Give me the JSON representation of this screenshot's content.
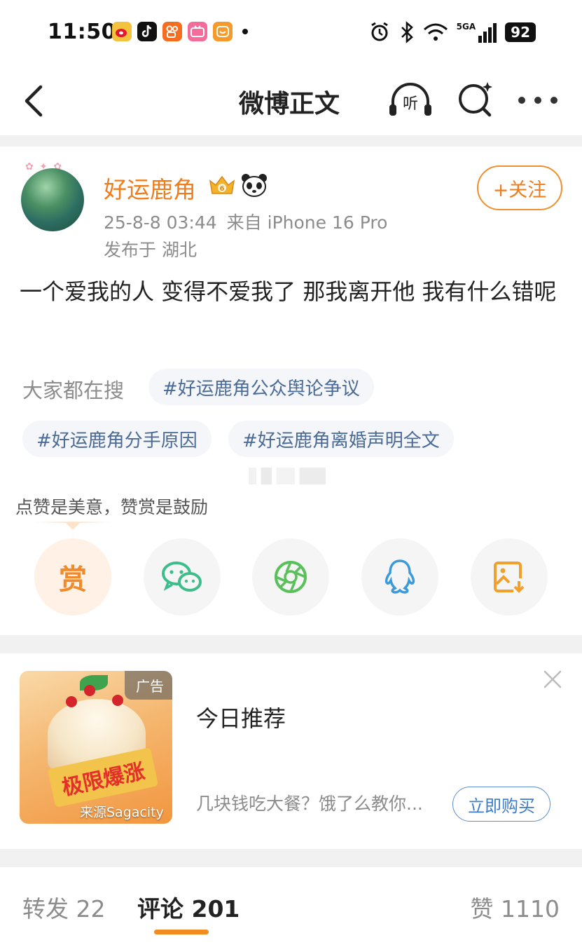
{
  "status_bar": {
    "time": "11:50",
    "battery": "92",
    "network": "5GA",
    "app_icons": [
      "weibo-icon",
      "tiktok-icon",
      "kuaishou-icon",
      "bilibili-icon",
      "taobao-icon"
    ]
  },
  "nav": {
    "title": "微博正文",
    "listen_label": "听"
  },
  "post": {
    "username": "好运鹿角",
    "follow_label": "+关注",
    "date": "25-8-8 03:44",
    "source": "来自 iPhone 16 Pro",
    "location": "发布于 湖北",
    "text": "一个爱我的人 变得不爱我了 那我离开他 我有什么错呢"
  },
  "hot_search": {
    "label": "大家都在搜",
    "tags": [
      "#好运鹿角公众舆论争议",
      "#好运鹿角分手原因",
      "#好运鹿角离婚声明全文"
    ]
  },
  "reward": {
    "tip": "点赞是美意，赞赏是鼓励",
    "reward_char": "赏"
  },
  "ad": {
    "label": "广告",
    "banner_text": "极限爆涨",
    "source": "来源Sagacity",
    "title": "今日推荐",
    "description": "几块钱吃大餐？饿了么教你...",
    "button": "立即购买"
  },
  "tabs": [
    {
      "label": "转发 22"
    },
    {
      "label": "评论 201"
    },
    {
      "label": "赞 1110"
    }
  ],
  "colors": {
    "accent": "#ee7d1e",
    "tag_text": "#4a6a97",
    "link_blue": "#3d7cc8"
  }
}
